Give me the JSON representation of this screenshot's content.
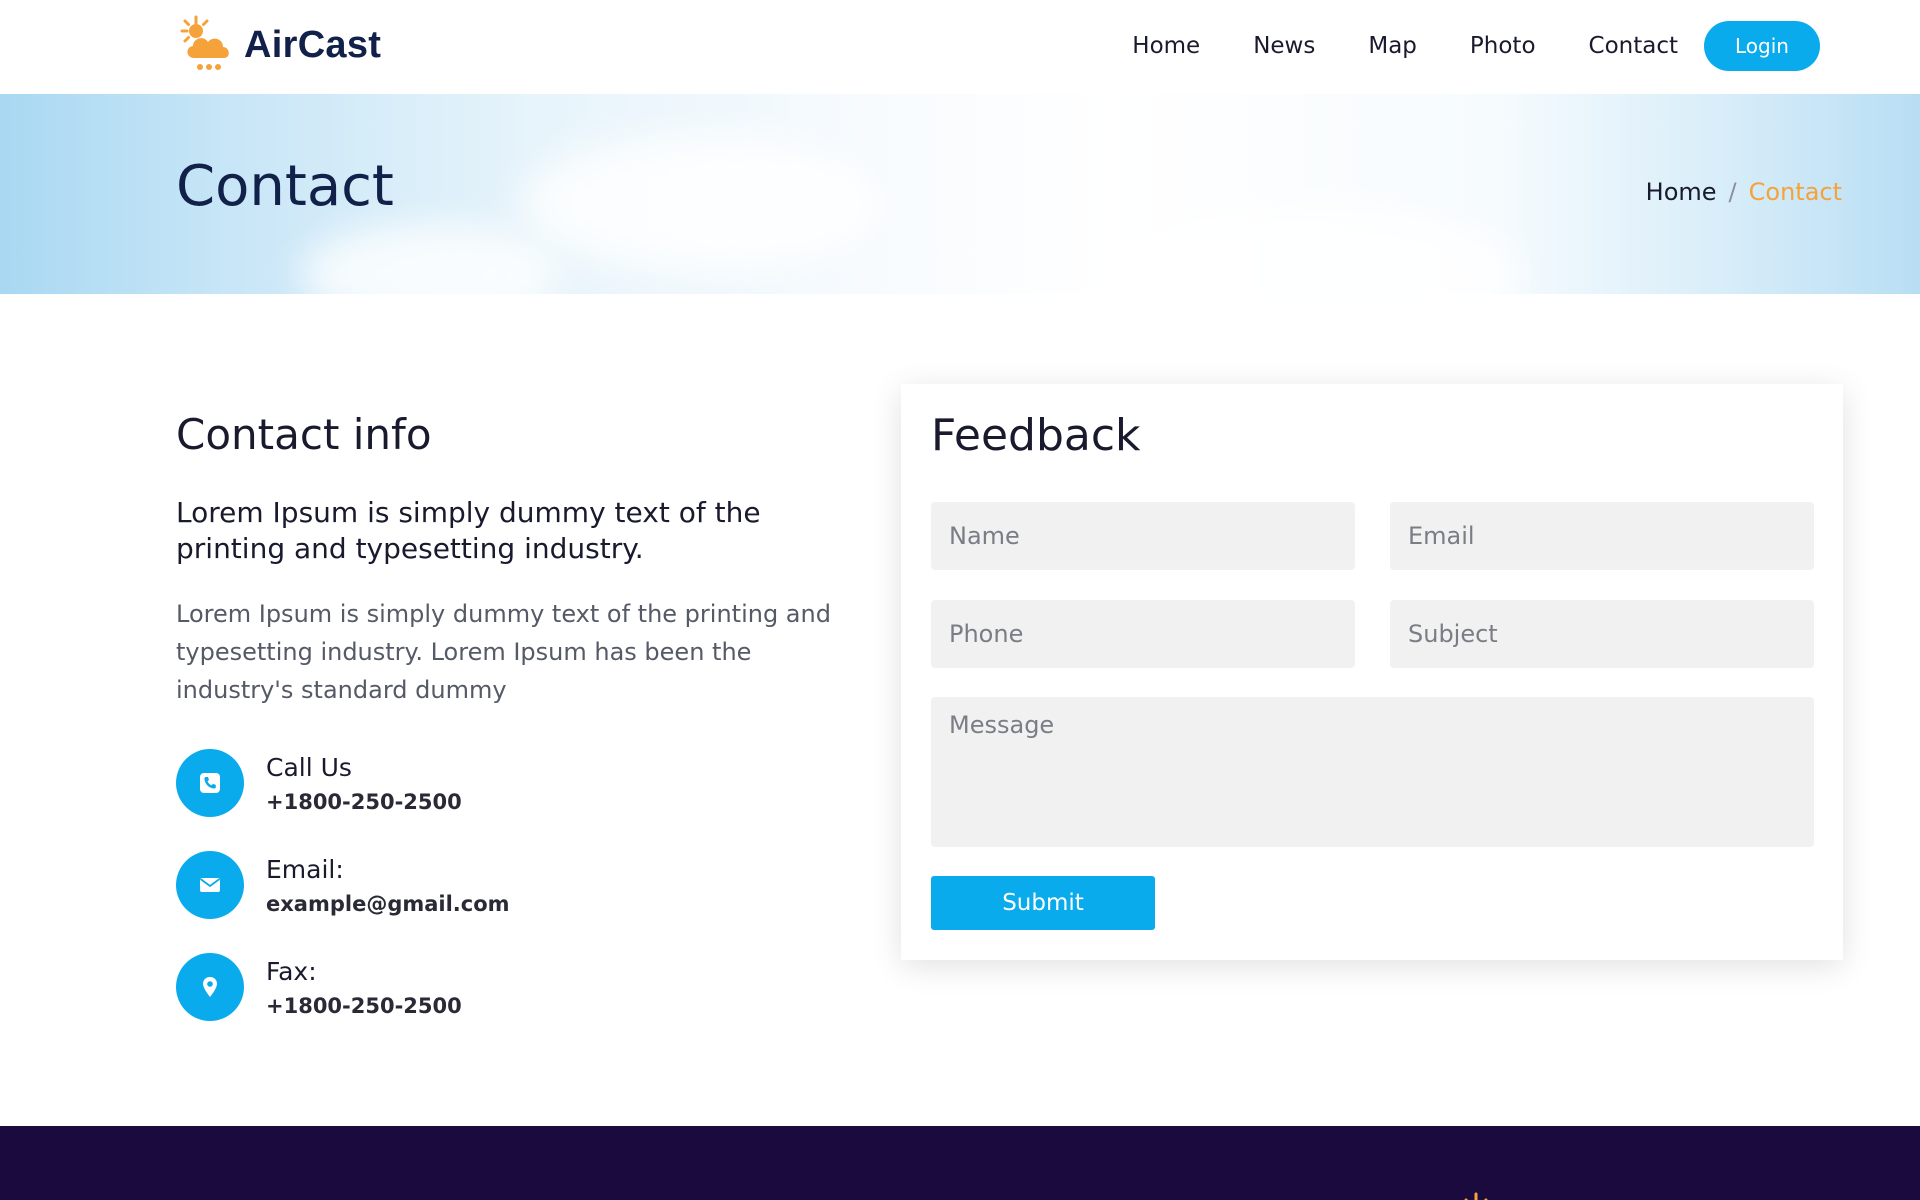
{
  "header": {
    "brand": "AirCast",
    "nav": [
      "Home",
      "News",
      "Map",
      "Photo",
      "Contact"
    ],
    "login_label": "Login"
  },
  "banner": {
    "title": "Contact",
    "breadcrumb": {
      "home": "Home",
      "separator": "/",
      "current": "Contact"
    }
  },
  "contact_info": {
    "title": "Contact info",
    "lead": "Lorem Ipsum is simply dummy text of the printing and typesetting industry.",
    "body": "Lorem Ipsum is simply dummy text of the printing and typesetting industry. Lorem Ipsum has been the industry's standard dummy",
    "items": [
      {
        "label": "Call Us",
        "value": "+1800-250-2500",
        "icon": "phone-icon"
      },
      {
        "label": "Email:",
        "value": "example@gmail.com",
        "icon": "envelope-icon"
      },
      {
        "label": "Fax:",
        "value": "+1800-250-2500",
        "icon": "location-pin-icon"
      }
    ]
  },
  "feedback": {
    "title": "Feedback",
    "placeholders": {
      "name": "Name",
      "email": "Email",
      "phone": "Phone",
      "subject": "Subject",
      "message": "Message"
    },
    "submit_label": "Submit"
  },
  "colors": {
    "accent": "#0aabec",
    "brand_orange": "#f6a23a",
    "heading": "#12214a",
    "footer_bg": "#1b0a3e"
  }
}
